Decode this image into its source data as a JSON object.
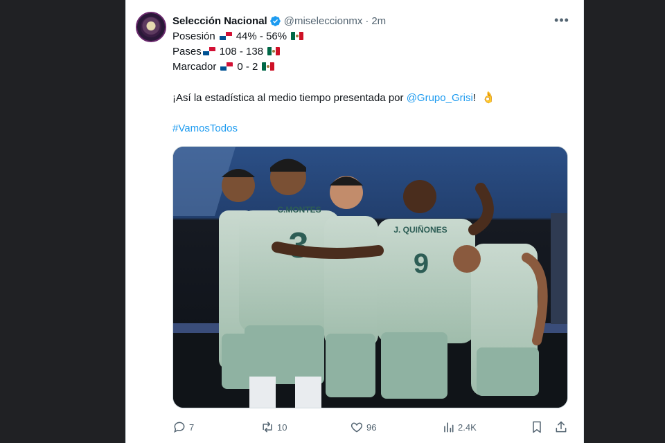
{
  "tweet": {
    "name": "Selección Nacional",
    "handle": "@miseleccionmx",
    "separator": "·",
    "time": "2m",
    "more_label": "•••",
    "lines": [
      {
        "label": "Posesión",
        "value": "44% - 56%"
      },
      {
        "label": "Pases",
        "value": "108 - 138"
      },
      {
        "label": "Marcador",
        "value": "0 - 2"
      }
    ],
    "sentence_prefix": "¡Así la estadística al medio tiempo presentada por ",
    "mention": "@Grupo_Grisi",
    "sentence_suffix": "!",
    "hand_emoji": "👌",
    "hashtag": "#VamosTodos",
    "media": {
      "jersey_names": [
        "C.MONTES",
        "J. QUIÑONES"
      ],
      "jersey_numbers": [
        "3",
        "9"
      ]
    }
  },
  "actions": {
    "replies": "7",
    "retweets": "10",
    "likes": "96",
    "views": "2.4K"
  },
  "icons": [
    "verified-badge-icon",
    "panama-flag-icon",
    "mexico-flag-icon",
    "ok-hand-icon",
    "reply-icon",
    "retweet-icon",
    "like-icon",
    "views-icon",
    "bookmark-icon",
    "share-icon"
  ],
  "colors": {
    "accent": "#1d9bf0",
    "text": "#0f1419",
    "secondary": "#536471",
    "background": "#ffffff",
    "page_background": "#202124"
  }
}
